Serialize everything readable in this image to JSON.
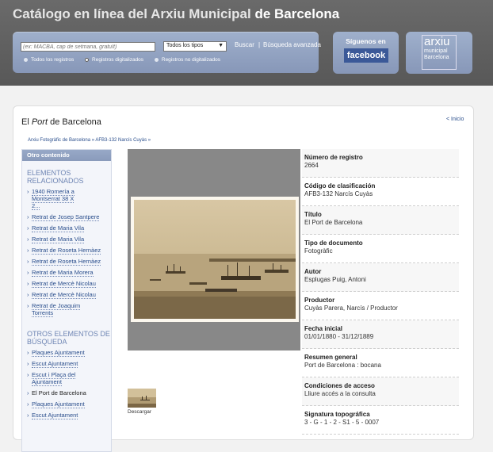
{
  "header": {
    "title_part1": "Catálogo en línea del Arxiu Municipal",
    "title_part2": "de Barcelona"
  },
  "search": {
    "placeholder": "(ex: MACBA, cap de setmana, gratuït)",
    "type_selected": "Todos los tipos",
    "search_button": "Buscar",
    "separator": "|",
    "advanced_link": "Búsqueda avanzada",
    "radios": [
      {
        "label": "Todos los registros",
        "selected": false
      },
      {
        "label": "Registros digitalizados",
        "selected": true
      },
      {
        "label": "Registros no digitalizados",
        "selected": false
      }
    ]
  },
  "facebook": {
    "label": "Síguenos en",
    "logo_text": "facebook"
  },
  "arxiu_logo": {
    "line1": "arxiu",
    "line2": "municipal",
    "line3": "Barcelona"
  },
  "page": {
    "title_prefix": "El",
    "title_em": "Port",
    "title_suffix": "de Barcelona",
    "back_link": "< Inicio",
    "breadcrumb": "Arxiu Fotogràfic de Barcelona » AFB3-132 Narcís Cuyàs »"
  },
  "sidebar": {
    "header": "Otro contenido",
    "section1_title": "ELEMENTOS RELACIONADOS",
    "section1_items": [
      "1940 Romería a Montserrat 38 X 2...",
      "Retrat de Josep Santpere",
      "Retrat de Maria Vila",
      "Retrat de Maria Vila",
      "Retrat de Roseta Hernàez",
      "Retrat de Roseta Hernàez",
      "Retrat de Maria Morera",
      "Retrat de Mercè Nicolau",
      "Retrat de Mercè Nicolau",
      "Retrat de Joaquim Torrents"
    ],
    "section2_title": "OTROS ELEMENTOS DE BÚSQUEDA",
    "section2_items": [
      "Plaques Ajuntament",
      "Escut Ajuntament",
      "Escut i Plaça del Ajuntament",
      "El Port de Barcelona",
      "Plaques Ajuntament",
      "Escut Ajuntament"
    ]
  },
  "image": {
    "download_label": "Descargar"
  },
  "metadata": [
    {
      "label": "Número de registro",
      "value": "2664"
    },
    {
      "label": "Código de clasificación",
      "value": "AFB3-132 Narcís Cuyàs"
    },
    {
      "label": "Título",
      "value": "El Port de Barcelona"
    },
    {
      "label": "Tipo de documento",
      "value": "Fotogràfic"
    },
    {
      "label": "Autor",
      "value": "Esplugas Puig, Antoni"
    },
    {
      "label": "Productor",
      "value": "Cuyàs Parera, Narcís / Productor"
    },
    {
      "label": "Fecha inicial",
      "value": "01/01/1880 - 31/12/1889"
    },
    {
      "label": "Resumen general",
      "value": "Port de Barcelona : bocana"
    },
    {
      "label": "Condiciones de acceso",
      "value": "Lliure accés a la consulta"
    },
    {
      "label": "Signatura topográfica",
      "value": "3 - G - 1 - 2 - S1 - 5 - 0007"
    }
  ]
}
